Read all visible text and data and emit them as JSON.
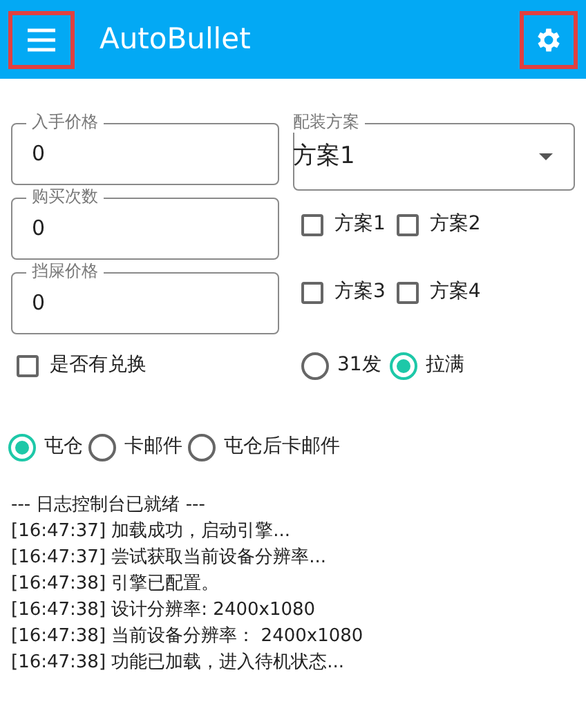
{
  "app_bar": {
    "title": "AutoBullet",
    "menu_highlighted": true,
    "settings_highlighted": true
  },
  "fields": [
    {
      "label": "入手价格",
      "value": "0"
    },
    {
      "label": "购买次数",
      "value": "0"
    },
    {
      "label": "挡屎价格",
      "value": "0"
    }
  ],
  "preset_dropdown": {
    "label": "配装方案",
    "value": "方案1"
  },
  "preset_checks": [
    {
      "label": "方案1",
      "checked": false
    },
    {
      "label": "方案2",
      "checked": false
    },
    {
      "label": "方案3",
      "checked": false
    },
    {
      "label": "方案4",
      "checked": false
    }
  ],
  "exchange_check": {
    "label": "是否有兑换",
    "checked": false
  },
  "fill_radios": [
    {
      "label": "31发",
      "selected": false
    },
    {
      "label": "拉满",
      "selected": true
    }
  ],
  "mode_radios": [
    {
      "label": "屯仓",
      "selected": true
    },
    {
      "label": "卡邮件",
      "selected": false
    },
    {
      "label": "屯仓后卡邮件",
      "selected": false
    }
  ],
  "log": [
    "--- 日志控制台已就绪 ---",
    "[16:47:37] 加载成功，启动引擎...",
    "[16:47:37] 尝试获取当前设备分辨率...",
    "[16:47:38] 引擎已配置。",
    "[16:47:38] 设计分辨率: 2400x1080",
    "[16:47:38] 当前设备分辨率： 2400x1080",
    "[16:47:38] 功能已加载，进入待机状态..."
  ]
}
